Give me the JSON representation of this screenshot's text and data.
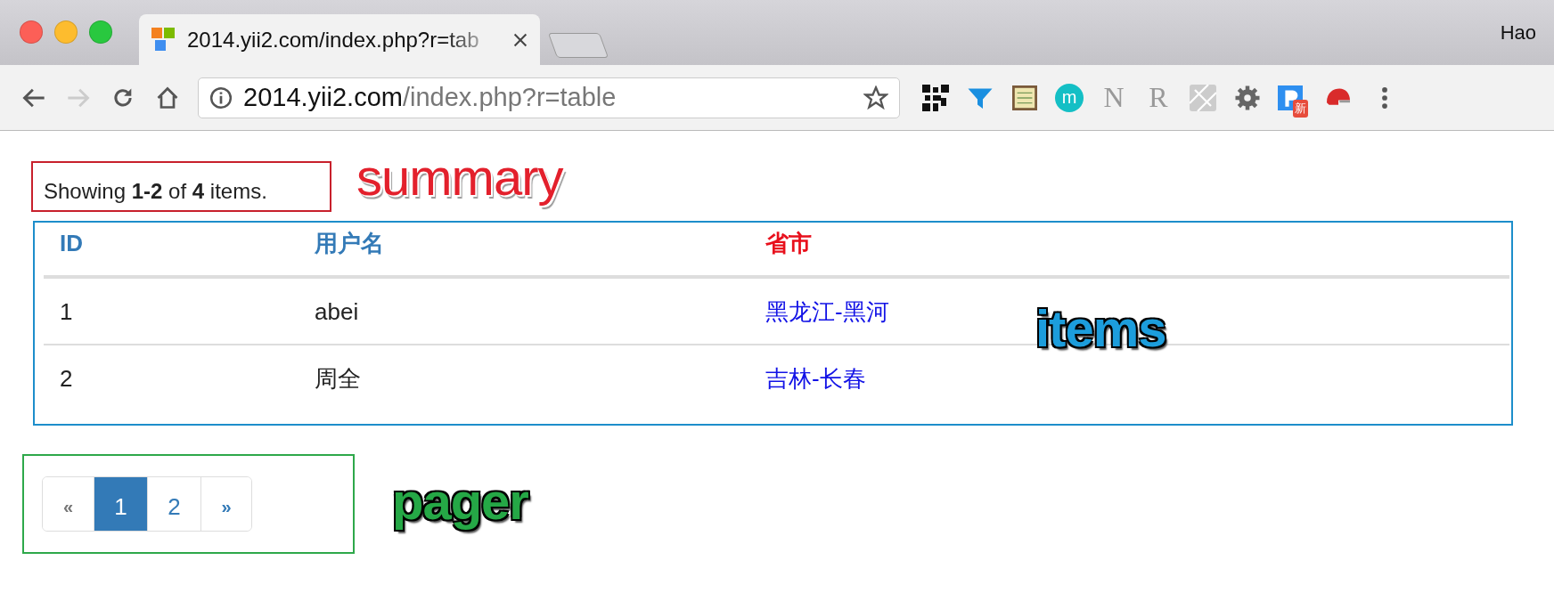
{
  "browser": {
    "tab": {
      "title": "2014.yii2.com/index.php?r=tab",
      "selected": true
    },
    "profile": "Hao",
    "address": {
      "host": "2014.yii2.com",
      "path": "/index.php?r=table"
    },
    "extensions": [
      {
        "kind": "qr"
      },
      {
        "kind": "funnel"
      },
      {
        "kind": "notes"
      },
      {
        "kind": "circle",
        "label": "m"
      },
      {
        "kind": "letter",
        "label": "N"
      },
      {
        "kind": "letter",
        "label": "R"
      },
      {
        "kind": "map"
      },
      {
        "kind": "gear"
      },
      {
        "kind": "badge",
        "badge": "新"
      },
      {
        "kind": "helmet"
      }
    ]
  },
  "summary": {
    "text": "Showing **1-2** of **4** items.",
    "note": {
      "label": "summary",
      "color": "#e3202c"
    }
  },
  "table": {
    "columns": [
      {
        "label": "ID",
        "color": "#337ab7"
      },
      {
        "label": "用户名",
        "color": "#337ab7"
      },
      {
        "label": "省市",
        "color": "#e8101c"
      }
    ],
    "rows": [
      {
        "cells": [
          "1",
          "abei",
          "黑龙江-黑河"
        ]
      },
      {
        "cells": [
          "2",
          "周全",
          "吉林-长春"
        ]
      }
    ],
    "note": {
      "label": "items",
      "color": "#1c9ddc"
    }
  },
  "pager_note": {
    "label": "pager",
    "color": "#25a846"
  },
  "pager": [
    {
      "label": "«",
      "kind": "prev",
      "selected": false,
      "disabled": true
    },
    {
      "label": "1",
      "kind": "page",
      "selected": true,
      "disabled": false
    },
    {
      "label": "2",
      "kind": "page",
      "selected": false,
      "disabled": false
    },
    {
      "label": "»",
      "kind": "next",
      "selected": false,
      "disabled": false
    }
  ]
}
